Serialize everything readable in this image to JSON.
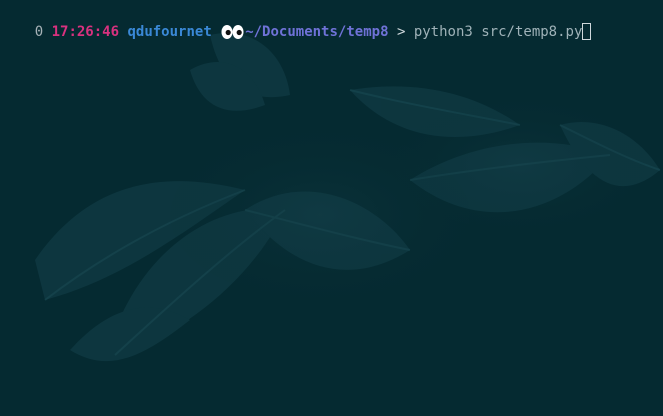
{
  "terminal": {
    "exit_code": "0",
    "time": "17:26:46",
    "user": "qdufournet",
    "eyes_icon": "eyes-icon",
    "path": "~/Documents/temp8",
    "prompt_symbol": ">",
    "command": "python3 src/temp8.py"
  },
  "colors": {
    "background": "#052a31",
    "time": "#d9317f",
    "user": "#3a88d6",
    "path": "#6f72d7",
    "command": "#9fb2b8"
  }
}
